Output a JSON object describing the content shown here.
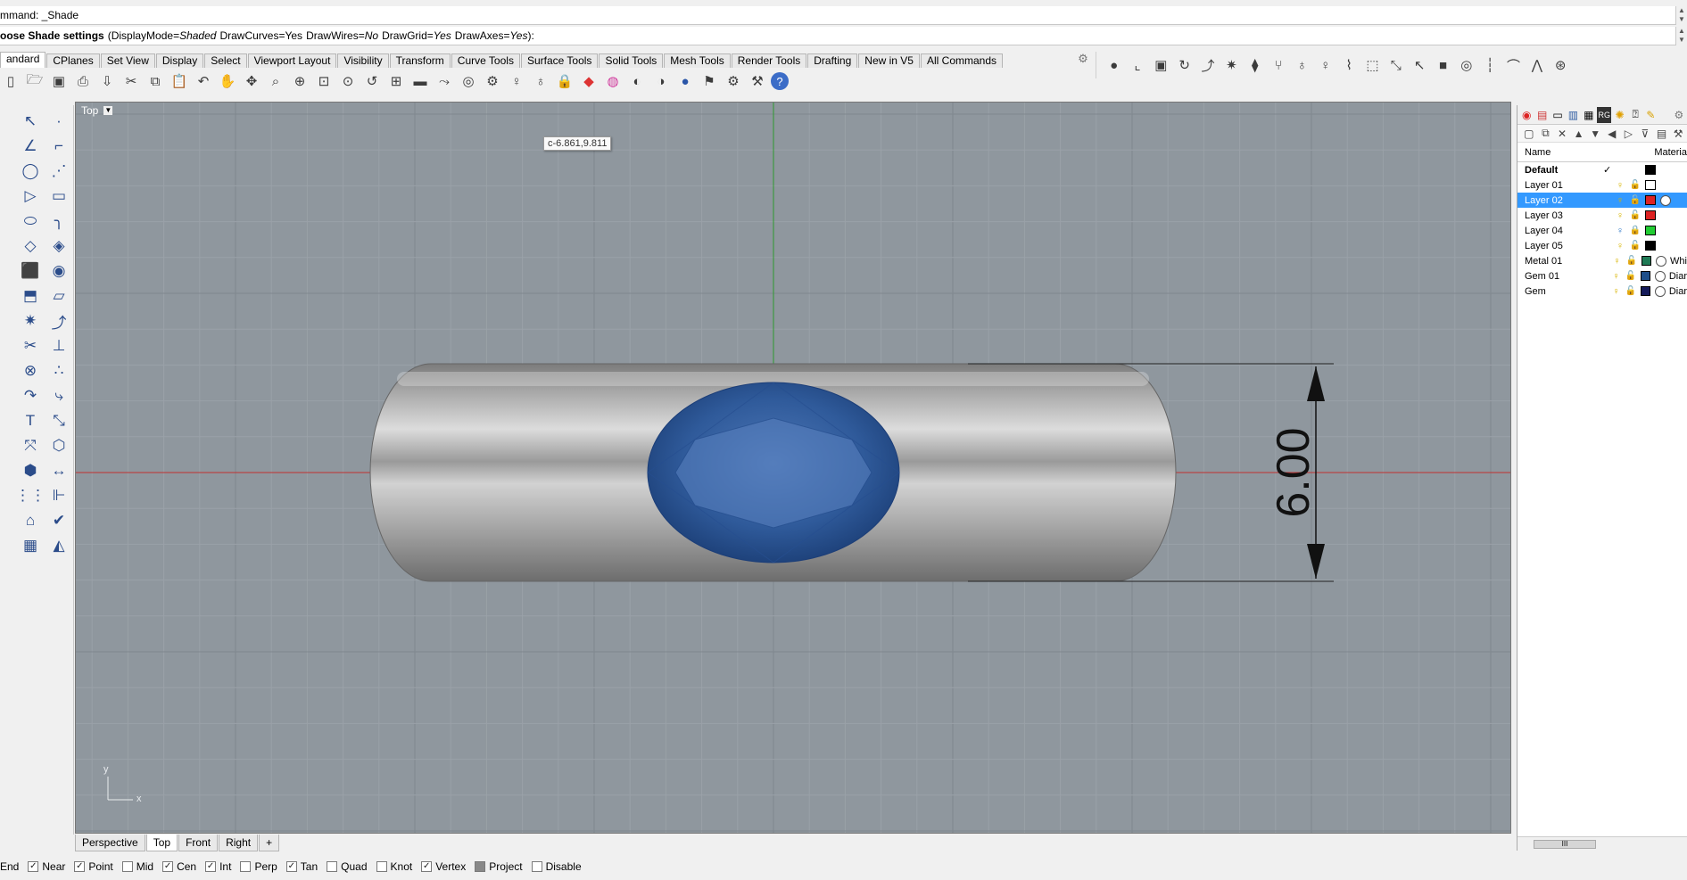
{
  "command": {
    "history": "mmand: _Shade",
    "prompt_label": "oose Shade settings",
    "prompt_paren_open": "(",
    "opt_displaymode_key": "DisplayMode=",
    "opt_displaymode_val": "Shaded",
    "opt_drawcurves_key": "DrawCurves=",
    "opt_drawcurves_val": "Yes",
    "opt_drawwires_key": "DrawWires=",
    "opt_drawwires_val": "No",
    "opt_drawgrid_key": "DrawGrid=",
    "opt_drawgrid_val": "Yes",
    "opt_drawaxes_key": "DrawAxes=",
    "opt_drawaxes_val": "Yes",
    "prompt_paren_close": "):"
  },
  "toolbar_tabs": [
    "andard",
    "CPlanes",
    "Set View",
    "Display",
    "Select",
    "Viewport Layout",
    "Visibility",
    "Transform",
    "Curve Tools",
    "Surface Tools",
    "Solid Tools",
    "Mesh Tools",
    "Render Tools",
    "Drafting",
    "New in V5",
    "All Commands"
  ],
  "toolbar_icons": [
    "new-file-icon",
    "open-folder-icon",
    "save-icon",
    "print-icon",
    "import-icon",
    "cut-icon",
    "copy-icon",
    "paste-icon",
    "undo-icon",
    "pan-hand-icon",
    "rotate-view-icon",
    "zoom-window-icon",
    "zoom-dynamic-icon",
    "zoom-extents-icon",
    "zoom-selected-icon",
    "undo-view-icon",
    "four-views-icon",
    "cplane-icon",
    "car-mode-icon",
    "osnap-icon",
    "lock-icon",
    "light-icon",
    "bulb-icon",
    "padlock-icon",
    "layer-icon",
    "color-wheel-icon",
    "wireframe-sphere-icon",
    "shaded-sphere-icon",
    "rendered-sphere-icon",
    "render-icon",
    "options-icon",
    "tools-icon",
    "help-icon"
  ],
  "viewport": {
    "title": "Top",
    "coord_tooltip": "c-6.861,9.811",
    "dimension_value": "6.00",
    "axis_y_label": "y",
    "axis_x_label": "x"
  },
  "viewport_tabs": [
    "Perspective",
    "Top",
    "Front",
    "Right"
  ],
  "viewport_tab_add": "+",
  "osnaps": [
    {
      "label": "End",
      "checked": true
    },
    {
      "label": "Near",
      "checked": true
    },
    {
      "label": "Point",
      "checked": true
    },
    {
      "label": "Mid",
      "checked": false
    },
    {
      "label": "Cen",
      "checked": true
    },
    {
      "label": "Int",
      "checked": true
    },
    {
      "label": "Perp",
      "checked": false
    },
    {
      "label": "Tan",
      "checked": true
    },
    {
      "label": "Quad",
      "checked": false
    },
    {
      "label": "Knot",
      "checked": false
    },
    {
      "label": "Vertex",
      "checked": true
    },
    {
      "label": "Project",
      "checked": false
    },
    {
      "label": "Disable",
      "checked": false
    }
  ],
  "layers": {
    "col_name": "Name",
    "col_material": "Materia",
    "rows": [
      {
        "name": "Default",
        "current": true,
        "color": "#000000",
        "material": ""
      },
      {
        "name": "Layer 01",
        "current": false,
        "color": "#ffffff",
        "material": ""
      },
      {
        "name": "Layer 02",
        "current": false,
        "color": "#dd2222",
        "material": "",
        "selected": true
      },
      {
        "name": "Layer 03",
        "current": false,
        "color": "#dd2222",
        "material": ""
      },
      {
        "name": "Layer 04",
        "current": false,
        "color": "#22cc33",
        "material": ""
      },
      {
        "name": "Layer 05",
        "current": false,
        "color": "#000000",
        "material": ""
      },
      {
        "name": "Metal 01",
        "current": false,
        "color": "#1f7a55",
        "material": "Whi"
      },
      {
        "name": "Gem 01",
        "current": false,
        "color": "#1e4f8a",
        "material": "Diar"
      },
      {
        "name": "Gem",
        "current": false,
        "color": "#151b5a",
        "material": "Diar"
      }
    ]
  },
  "colors": {
    "viewport_bg": "#8f979e",
    "grid_minor": "#9aa1a8",
    "grid_major": "#7f878e",
    "x_axis": "#c03030",
    "y_axis": "#2e9a2e",
    "gem_blue": "#2f5a9a",
    "band_gray": "#9c9c9c"
  }
}
